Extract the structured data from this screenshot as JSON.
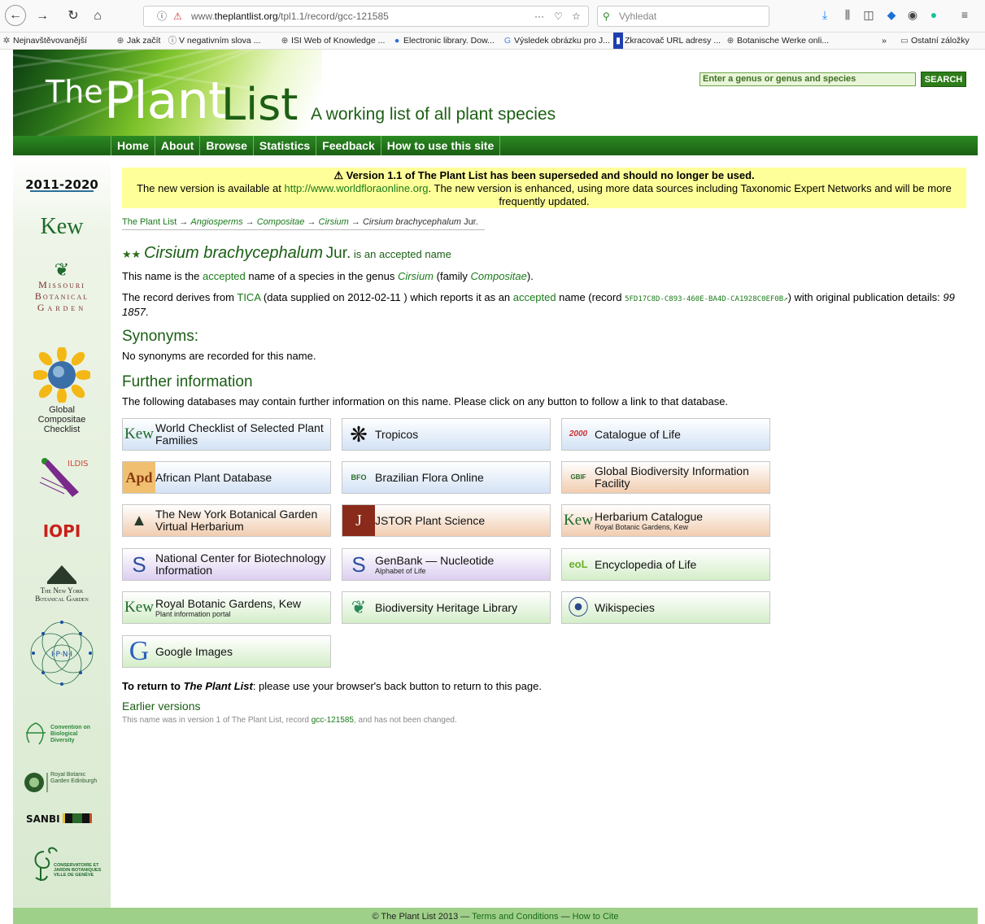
{
  "browser": {
    "url_prefix": "www.",
    "url_domain": "theplantlist.org",
    "url_path": "/tpl1.1/record/gcc-121585",
    "search_placeholder": "Vyhledat",
    "bookmarks": [
      "Nejnavštěvovanější",
      "Jak začít",
      "V negativním slova ...",
      "ISI Web of Knowledge ...",
      "Electronic library. Dow...",
      "Výsledek obrázku pro J...",
      "Zkracovač URL adresy ...",
      "Botanische Werke onli...",
      "Ostatní záložky"
    ]
  },
  "header": {
    "logo_the": "The",
    "logo_plant": "Plant",
    "logo_list": "List",
    "tagline": "A working list of all plant species",
    "search_placeholder": "Enter a genus or genus and species",
    "search_button": "SEARCH"
  },
  "nav": [
    "Home",
    "About",
    "Browse",
    "Statistics",
    "Feedback",
    "How to use this site"
  ],
  "partners": {
    "missouri_1": "Missouri",
    "missouri_2": "Botanical",
    "missouri_3": "Garden",
    "global_compositae": "Global Compositae Checklist",
    "iopi": "IOPI",
    "ny_1": "The New York",
    "ny_2": "Botanical Garden",
    "ipni": "I·P·N·I",
    "cbd": "Convention on Biological Diversity",
    "rbge": "Royal Botanic Garden Edinburgh",
    "sanbi": "SANBI",
    "geneve": "CONSERVATOIRE ET JARDIN BOTANIQUES VILLE DE GENÈVE",
    "kew": "Kew",
    "ildis": "ILDIS",
    "cbd_year": "2011-2020"
  },
  "notice": {
    "title": "⚠ Version 1.1 of The Plant List has been superseded and should no longer be used.",
    "line_a": "The new version is available at ",
    "link": "http://www.worldfloraonline.org",
    "line_b": ". The new version is enhanced, using more data sources including Taxonomic Expert Networks and will be more frequently updated."
  },
  "breadcrumb": {
    "root": "The Plant List",
    "sep": " → ",
    "major_group": "Angiosperms",
    "family": "Compositae",
    "genus": "Cirsium",
    "species": "Cirsium brachycephalum",
    "author": "Jur."
  },
  "record": {
    "name": "Cirsium brachycephalum",
    "author": "Jur.",
    "status_text": "is an accepted name",
    "p1_a": "This name is the ",
    "p1_accepted": "accepted",
    "p1_b": " name of a species in the genus ",
    "p1_genus": "Cirsium",
    "p1_c": " (family ",
    "p1_family": "Compositae",
    "p1_d": ").",
    "p2_a": "The record derives from ",
    "p2_source": "TICA",
    "p2_b": " (data supplied on 2012-02-11 ) which reports it as an ",
    "p2_accepted": "accepted",
    "p2_c": " name (record ",
    "p2_record": "5FD17C8D-C893-460E-BA4D-CA1928C0EF0B↗",
    "p2_d": ") with original publication details: ",
    "p2_pub": "99 1857",
    "p2_e": "."
  },
  "synonyms": {
    "heading": "Synonyms:",
    "text": "No synonyms are recorded for this name."
  },
  "further": {
    "heading": "Further information",
    "text": "The following databases may contain further information on this name. Please click on any button to follow a link to that database."
  },
  "databases": [
    {
      "label": "World Checklist of Selected Plant Families",
      "sub": "",
      "icon": "Kew",
      "color": "blue"
    },
    {
      "label": "Tropicos",
      "sub": "",
      "icon": "❋",
      "color": "blue"
    },
    {
      "label": "Catalogue of Life",
      "sub": "",
      "icon": "2000",
      "color": "blue"
    },
    {
      "label": "African Plant Database",
      "sub": "",
      "icon": "Apd",
      "color": "blue"
    },
    {
      "label": "Brazilian Flora Online",
      "sub": "",
      "icon": "BFO",
      "color": "blue"
    },
    {
      "label": "Global Biodiversity Information Facility",
      "sub": "",
      "icon": "GBIF",
      "color": "orange"
    },
    {
      "label": "The New York Botanical Garden Virtual Herbarium",
      "sub": "",
      "icon": "▲",
      "color": "orange"
    },
    {
      "label": "JSTOR Plant Science",
      "sub": "",
      "icon": "J",
      "color": "orange"
    },
    {
      "label": "Herbarium Catalogue",
      "sub": "Royal Botanic Gardens, Kew",
      "icon": "Kew",
      "color": "orange"
    },
    {
      "label": "National Center for Biotechnology Information",
      "sub": "",
      "icon": "S",
      "color": "purple"
    },
    {
      "label": "GenBank — Nucleotide",
      "sub": "Alphabet of Life",
      "icon": "S",
      "color": "purple"
    },
    {
      "label": "Encyclopedia of Life",
      "sub": "",
      "icon": "eoL",
      "color": "green"
    },
    {
      "label": "Royal Botanic Gardens, Kew",
      "sub": "Plant information portal",
      "icon": "Kew",
      "color": "green"
    },
    {
      "label": "Biodiversity Heritage Library",
      "sub": "",
      "icon": "❦",
      "color": "green"
    },
    {
      "label": "Wikispecies",
      "sub": "",
      "icon": "⦿",
      "color": "green"
    },
    {
      "label": "Google Images",
      "sub": "",
      "icon": "G",
      "color": "green"
    }
  ],
  "return_line": {
    "a": "To return to ",
    "b": "The Plant List",
    "c": ": please use your browser's back button to return to this page."
  },
  "earlier": {
    "heading": "Earlier versions",
    "a": "This name was in version 1 of The Plant List, record ",
    "record": "gcc-121585",
    "b": ", and has not been changed."
  },
  "footer": {
    "copy": "© The Plant List 2013 — ",
    "terms": "Terms and Conditions",
    "sep": " — ",
    "cite": "How to Cite"
  }
}
